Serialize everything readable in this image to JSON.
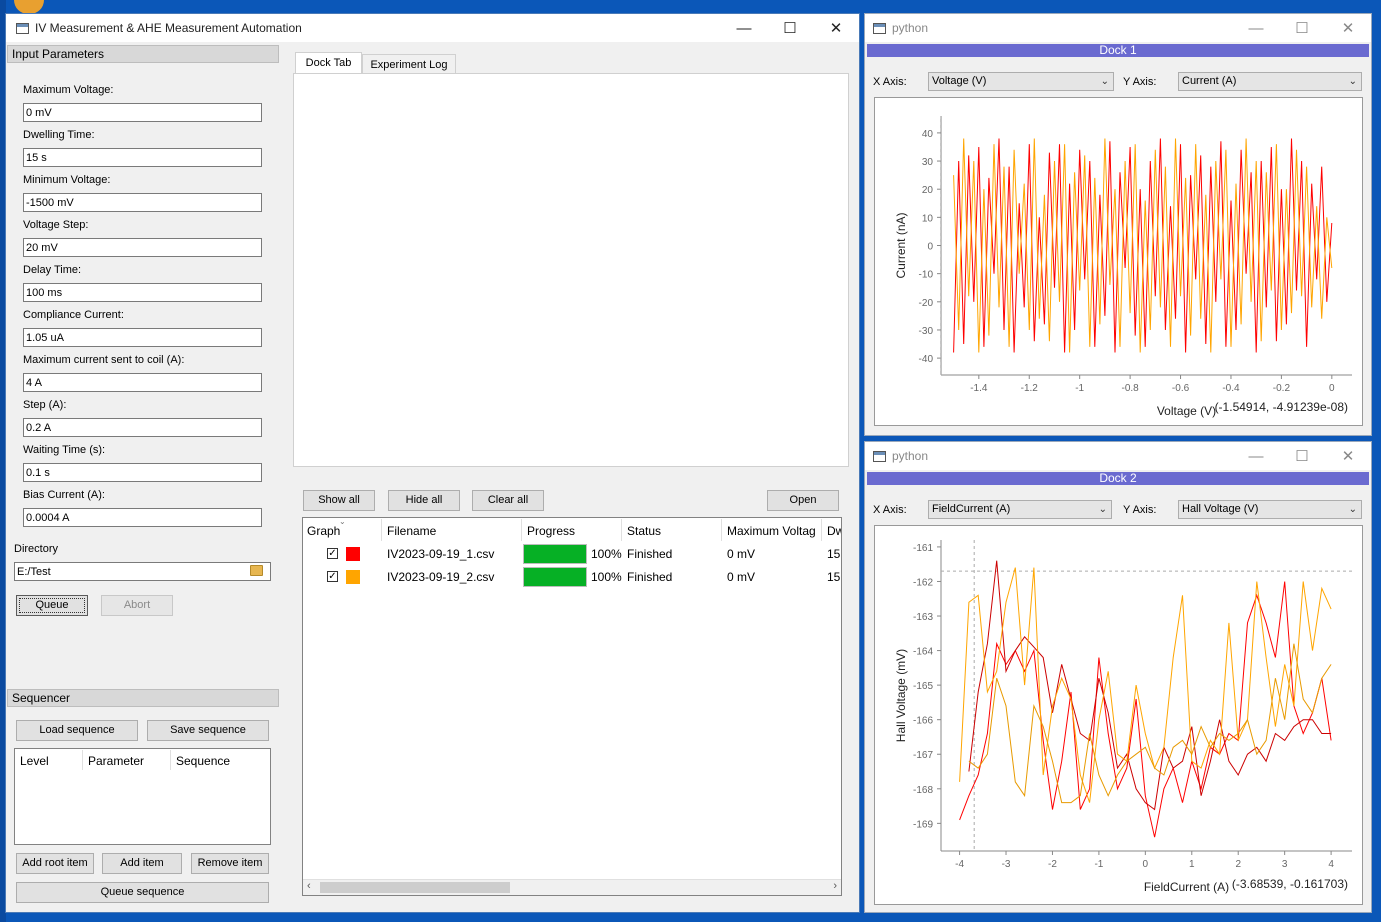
{
  "main_window": {
    "title": "IV Measurement & AHE Measurement Automation",
    "input_params": {
      "header": "Input Parameters",
      "fields": [
        {
          "label": "Maximum Voltage:",
          "value": "0 mV"
        },
        {
          "label": "Dwelling Time:",
          "value": "15 s"
        },
        {
          "label": "Minimum Voltage:",
          "value": "-1500 mV"
        },
        {
          "label": "Voltage Step:",
          "value": "20 mV"
        },
        {
          "label": "Delay Time:",
          "value": "100 ms"
        },
        {
          "label": "Compliance Current:",
          "value": "1.05 uA"
        },
        {
          "label": "Maximum current sent to coil (A):",
          "value": "4 A"
        },
        {
          "label": "Step (A):",
          "value": "0.2 A"
        },
        {
          "label": "Waiting Time (s):",
          "value": "0.1 s"
        },
        {
          "label": "Bias Current (A):",
          "value": "0.0004 A"
        }
      ],
      "directory_label": "Directory",
      "directory_value": "E:/Test",
      "queue_label": "Queue",
      "abort_label": "Abort"
    },
    "sequencer": {
      "header": "Sequencer",
      "load_label": "Load sequence",
      "save_label": "Save sequence",
      "columns": [
        "Level",
        "Parameter",
        "Sequence"
      ],
      "add_root_label": "Add root item",
      "add_item_label": "Add item",
      "remove_item_label": "Remove item",
      "queue_sequence_label": "Queue sequence"
    },
    "tabs": [
      "Dock Tab",
      "Experiment Log"
    ],
    "results": {
      "show_all": "Show all",
      "hide_all": "Hide all",
      "clear_all": "Clear all",
      "open": "Open",
      "columns": [
        "Graph",
        "Filename",
        "Progress",
        "Status",
        "Maximum Voltag",
        "Dw"
      ],
      "rows": [
        {
          "filename": "IV2023-09-19_1.csv",
          "progress_pct": 100,
          "progress_text": "100%",
          "status": "Finished",
          "max_voltage": "0 mV",
          "dwell": "15",
          "color": "#ff0000",
          "checked": "✓"
        },
        {
          "filename": "IV2023-09-19_2.csv",
          "progress_pct": 100,
          "progress_text": "100%",
          "status": "Finished",
          "max_voltage": "0 mV",
          "dwell": "15",
          "color": "#ffa500",
          "checked": "✓"
        }
      ]
    }
  },
  "plot_window_1": {
    "title": "python",
    "dock_label": "Dock 1",
    "x_axis_label": "X Axis:",
    "x_axis_value": "Voltage (V)",
    "y_axis_label": "Y Axis:",
    "y_axis_value": "Current (A)",
    "readout": "(-1.54914, -4.91239e-08)"
  },
  "plot_window_2": {
    "title": "python",
    "dock_label": "Dock 2",
    "x_axis_label": "X Axis:",
    "x_axis_value": "FieldCurrent (A)",
    "y_axis_label": "Y Axis:",
    "y_axis_value": "Hall Voltage (V)",
    "readout": "(-3.68539, -0.161703)"
  },
  "chart_data": [
    {
      "type": "line",
      "xlabel": "Voltage (V)",
      "ylabel": "Current (nA)",
      "xlim": [
        -1.55,
        0.08
      ],
      "ylim": [
        -46,
        46
      ],
      "xticks": [
        -1.4,
        -1.2,
        -1,
        -0.8,
        -0.6,
        -0.4,
        -0.2,
        0
      ],
      "xtick_labels": [
        "-1.4",
        "-1.2",
        "-1",
        "-0.8",
        "-0.6",
        "-0.4",
        "-0.2",
        "0"
      ],
      "yticks": [
        40,
        30,
        20,
        10,
        0,
        -10,
        -20,
        -30,
        -40
      ],
      "ytick_labels": [
        "40",
        "30",
        "20",
        "10",
        "0",
        "-10",
        "-20",
        "-30",
        "-40"
      ],
      "grid": false,
      "crosshair_x": -1.54914,
      "series": [
        {
          "color": "#ff0000",
          "x": [
            -1.5,
            -1.48,
            -1.46,
            -1.44,
            -1.42,
            -1.4,
            -1.38,
            -1.36,
            -1.34,
            -1.32,
            -1.3,
            -1.28,
            -1.26,
            -1.24,
            -1.22,
            -1.2,
            -1.18,
            -1.16,
            -1.14,
            -1.12,
            -1.1,
            -1.08,
            -1.06,
            -1.04,
            -1.02,
            -1,
            -0.98,
            -0.96,
            -0.94,
            -0.92,
            -0.9,
            -0.88,
            -0.86,
            -0.84,
            -0.82,
            -0.8,
            -0.78,
            -0.76,
            -0.74,
            -0.72,
            -0.7,
            -0.68,
            -0.66,
            -0.64,
            -0.62,
            -0.6,
            -0.58,
            -0.56,
            -0.54,
            -0.52,
            -0.5,
            -0.48,
            -0.46,
            -0.44,
            -0.42,
            -0.4,
            -0.38,
            -0.36,
            -0.34,
            -0.32,
            -0.3,
            -0.28,
            -0.26,
            -0.24,
            -0.22,
            -0.2,
            -0.18,
            -0.16,
            -0.14,
            -0.12,
            -0.1,
            -0.08,
            -0.06,
            -0.04,
            -0.02,
            0
          ],
          "y": [
            -38,
            30,
            -35,
            32,
            -20,
            35,
            -36,
            24,
            -10,
            38,
            -30,
            28,
            -38,
            15,
            -22,
            36,
            -34,
            10,
            -28,
            33,
            -15,
            36,
            -38,
            22,
            -30,
            34,
            -12,
            30,
            -36,
            18,
            -25,
            37,
            -38,
            26,
            -8,
            35,
            -32,
            20,
            -36,
            30,
            -18,
            38,
            -30,
            14,
            -26,
            36,
            -38,
            25,
            -12,
            32,
            -35,
            28,
            -20,
            37,
            -36,
            16,
            -30,
            34,
            -10,
            26,
            -38,
            30,
            -22,
            35,
            -34,
            20,
            -28,
            38,
            -16,
            30,
            -36,
            22,
            -12,
            28,
            -20,
            8
          ]
        },
        {
          "color": "#ffa500",
          "x": [
            -1.5,
            -1.48,
            -1.46,
            -1.44,
            -1.42,
            -1.4,
            -1.38,
            -1.36,
            -1.34,
            -1.32,
            -1.3,
            -1.28,
            -1.26,
            -1.24,
            -1.22,
            -1.2,
            -1.18,
            -1.16,
            -1.14,
            -1.12,
            -1.1,
            -1.08,
            -1.06,
            -1.04,
            -1.02,
            -1,
            -0.98,
            -0.96,
            -0.94,
            -0.92,
            -0.9,
            -0.88,
            -0.86,
            -0.84,
            -0.82,
            -0.8,
            -0.78,
            -0.76,
            -0.74,
            -0.72,
            -0.7,
            -0.68,
            -0.66,
            -0.64,
            -0.62,
            -0.6,
            -0.58,
            -0.56,
            -0.54,
            -0.52,
            -0.5,
            -0.48,
            -0.46,
            -0.44,
            -0.42,
            -0.4,
            -0.38,
            -0.36,
            -0.34,
            -0.32,
            -0.3,
            -0.28,
            -0.26,
            -0.24,
            -0.22,
            -0.2,
            -0.18,
            -0.16,
            -0.14,
            -0.12,
            -0.1,
            -0.08,
            -0.06,
            -0.04,
            -0.02,
            0
          ],
          "y": [
            25,
            -30,
            38,
            -18,
            30,
            -38,
            20,
            -32,
            36,
            -22,
            28,
            -36,
            34,
            -10,
            22,
            -30,
            38,
            -26,
            18,
            -34,
            30,
            -20,
            36,
            -38,
            26,
            -16,
            32,
            -36,
            24,
            -28,
            38,
            -14,
            20,
            -36,
            30,
            -24,
            36,
            -38,
            16,
            -30,
            34,
            -22,
            28,
            -36,
            38,
            -18,
            24,
            -32,
            36,
            -26,
            18,
            -38,
            30,
            -12,
            34,
            -36,
            22,
            -28,
            38,
            -20,
            30,
            -34,
            26,
            -16,
            36,
            -30,
            20,
            -24,
            34,
            -18,
            28,
            -22,
            14,
            -26,
            10,
            -8
          ]
        }
      ]
    },
    {
      "type": "line",
      "xlabel": "FieldCurrent (A)",
      "ylabel": "Hall Voltage (mV)",
      "xlim": [
        -4.4,
        4.45
      ],
      "ylim": [
        -169.8,
        -160.8
      ],
      "xticks": [
        -4,
        -3,
        -2,
        -1,
        0,
        1,
        2,
        3,
        4
      ],
      "xtick_labels": [
        "-4",
        "-3",
        "-2",
        "-1",
        "0",
        "1",
        "2",
        "3",
        "4"
      ],
      "yticks": [
        -161,
        -162,
        -163,
        -164,
        -165,
        -166,
        -167,
        -168,
        -169
      ],
      "ytick_labels": [
        "-161",
        "-162",
        "-163",
        "-164",
        "-165",
        "-166",
        "-167",
        "-168",
        "-169"
      ],
      "grid": false,
      "crosshair_x": -3.68539,
      "crosshair_y": -161.7,
      "series": [
        {
          "color": "#ff0000",
          "x": [
            -4,
            -3.8,
            -3.6,
            -3.4,
            -3.2,
            -3,
            -2.8,
            -2.6,
            -2.4,
            -2.2,
            -2,
            -1.8,
            -1.6,
            -1.4,
            -1.2,
            -1,
            -0.8,
            -0.6,
            -0.4,
            -0.2,
            0,
            0.2,
            0.4,
            0.6,
            0.8,
            1,
            1.2,
            1.4,
            1.6,
            1.8,
            2,
            2.2,
            2.4,
            2.6,
            2.8,
            3,
            3.2,
            3.4,
            3.6,
            3.8,
            4
          ],
          "y": [
            -168.9,
            -168.2,
            -167.6,
            -166.4,
            -163.8,
            -164.4,
            -164.0,
            -164.6,
            -164.0,
            -166.6,
            -168.6,
            -167.2,
            -165.2,
            -168.6,
            -168.0,
            -164.2,
            -166.4,
            -168.0,
            -167.4,
            -165.4,
            -168.2,
            -169.4,
            -168.0,
            -167.4,
            -168.4,
            -167.2,
            -168.0,
            -166.8,
            -167.0,
            -166.4,
            -166.6,
            -163.2,
            -162.4,
            -163.2,
            -164.2,
            -162.0,
            -165.6,
            -166.4,
            -165.8,
            -164.8,
            -166.6
          ]
        },
        {
          "color": "#cc0000",
          "x": [
            -3.8,
            -3.6,
            -3.4,
            -3.2,
            -3,
            -2.8,
            -2.6,
            -2.4,
            -2.2,
            -2,
            -1.8,
            -1.6,
            -1.4,
            -1.2,
            -1,
            -0.8,
            -0.6,
            -0.4,
            -0.2,
            0,
            0.2,
            0.4,
            0.6,
            0.8,
            1,
            1.2,
            1.4,
            1.6,
            1.8,
            2,
            2.2,
            2.4,
            2.6,
            2.8,
            3,
            3.2,
            3.4,
            3.6,
            3.8,
            4
          ],
          "y": [
            -167.5,
            -165.2,
            -163.8,
            -161.4,
            -164.6,
            -164.0,
            -163.6,
            -163.9,
            -164.2,
            -165.8,
            -164.4,
            -165.4,
            -166.4,
            -166.6,
            -164.8,
            -165.8,
            -167.4,
            -167.0,
            -168.0,
            -168.4,
            -168.6,
            -166.8,
            -167.4,
            -167.2,
            -166.2,
            -168.2,
            -167.2,
            -166.0,
            -167.2,
            -167.6,
            -167.0,
            -166.8,
            -167.2,
            -166.4,
            -166.6,
            -166.2,
            -166.0,
            -166.0,
            -166.4,
            -166.4
          ]
        },
        {
          "color": "#ffa500",
          "x": [
            -4,
            -3.8,
            -3.6,
            -3.4,
            -3.2,
            -3,
            -2.8,
            -2.6,
            -2.4,
            -2.2,
            -2,
            -1.8,
            -1.6,
            -1.4,
            -1.2,
            -1,
            -0.8,
            -0.6,
            -0.4,
            -0.2,
            0,
            0.2,
            0.4,
            0.6,
            0.8,
            1,
            1.2,
            1.4,
            1.6,
            1.8,
            2,
            2.2,
            2.4,
            2.6,
            2.8,
            3,
            3.2,
            3.4,
            3.6,
            3.8,
            4
          ],
          "y": [
            -167.8,
            -162.6,
            -162.4,
            -165.2,
            -164.6,
            -162.6,
            -161.6,
            -165.0,
            -161.6,
            -167.6,
            -165.6,
            -164.8,
            -165.4,
            -167.6,
            -168.4,
            -166.0,
            -164.6,
            -167.0,
            -167.2,
            -165.0,
            -166.4,
            -167.4,
            -166.8,
            -164.2,
            -162.4,
            -167.2,
            -167.4,
            -166.6,
            -167.0,
            -163.2,
            -166.6,
            -166.0,
            -162.0,
            -164.2,
            -166.2,
            -164.4,
            -165.6,
            -162.0,
            -164.0,
            -162.2,
            -162.8
          ]
        },
        {
          "color": "#e89a00",
          "x": [
            -3.8,
            -3.6,
            -3.4,
            -3.2,
            -3,
            -2.8,
            -2.6,
            -2.4,
            -2.2,
            -2,
            -1.8,
            -1.6,
            -1.4,
            -1.2,
            -1,
            -0.8,
            -0.6,
            -0.4,
            -0.2,
            0,
            0.2,
            0.4,
            0.6,
            0.8,
            1,
            1.2,
            1.4,
            1.6,
            1.8,
            2,
            2.2,
            2.4,
            2.6,
            2.8,
            3,
            3.2,
            3.4,
            3.6,
            3.8,
            4
          ],
          "y": [
            -167.2,
            -167.4,
            -167.0,
            -164.8,
            -165.6,
            -167.8,
            -168.2,
            -165.6,
            -166.2,
            -167.2,
            -168.4,
            -168.4,
            -168.2,
            -166.4,
            -167.6,
            -168.2,
            -167.6,
            -167.2,
            -167.0,
            -166.8,
            -167.4,
            -167.6,
            -166.8,
            -166.6,
            -167.0,
            -166.2,
            -166.8,
            -166.4,
            -166.6,
            -166.4,
            -166.0,
            -167.0,
            -166.6,
            -164.8,
            -166.0,
            -163.8,
            -165.4,
            -165.8,
            -164.8,
            -164.4
          ]
        }
      ]
    }
  ]
}
